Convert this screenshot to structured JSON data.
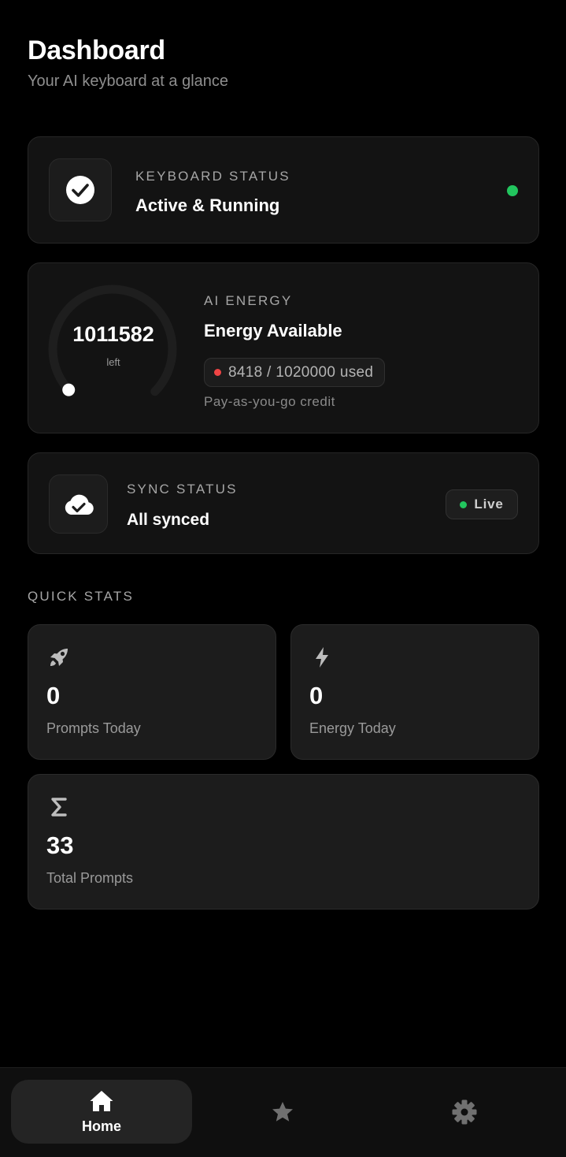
{
  "header": {
    "title": "Dashboard",
    "subtitle": "Your AI keyboard at a glance"
  },
  "keyboard_status": {
    "overline": "KEYBOARD STATUS",
    "title": "Active & Running",
    "icon": "check-circle-icon",
    "indicator_color": "#22c55e"
  },
  "ai_energy": {
    "overline": "AI ENERGY",
    "title": "Energy Available",
    "remaining": "1011582",
    "remaining_caption": "left",
    "usage_text": "8418 / 1020000 used",
    "used": 8418,
    "total": 1020000,
    "note": "Pay-as-you-go credit",
    "usage_dot_color": "#ef4444"
  },
  "sync_status": {
    "overline": "SYNC STATUS",
    "title": "All synced",
    "icon": "cloud-check-icon",
    "badge": "Live",
    "badge_dot_color": "#22c55e"
  },
  "quick_stats": {
    "label": "QUICK STATS",
    "items": [
      {
        "icon": "rocket-icon",
        "value": "0",
        "label": "Prompts Today"
      },
      {
        "icon": "bolt-icon",
        "value": "0",
        "label": "Energy Today"
      },
      {
        "icon": "sigma-icon",
        "value": "33",
        "label": "Total Prompts"
      }
    ]
  },
  "bottom_nav": {
    "items": [
      {
        "icon": "home-icon",
        "label": "Home",
        "active": true
      },
      {
        "icon": "star-icon",
        "label": "",
        "active": false
      },
      {
        "icon": "gear-icon",
        "label": "",
        "active": false
      }
    ]
  },
  "colors": {
    "background": "#000000",
    "card": "#131313",
    "stat_card": "#1c1c1c",
    "accent_green": "#22c55e",
    "accent_red": "#ef4444"
  }
}
